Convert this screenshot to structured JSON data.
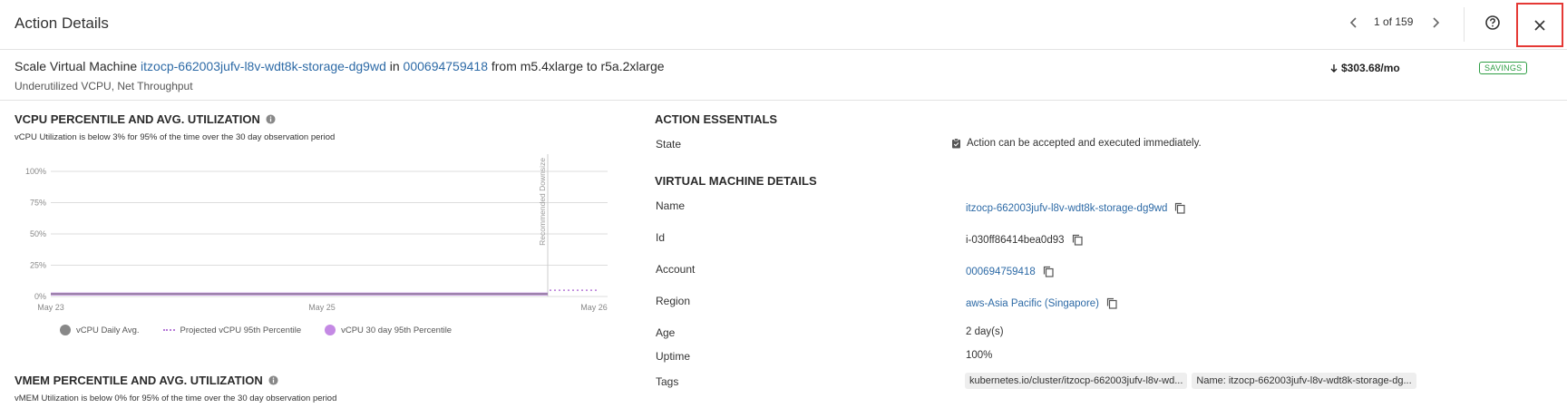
{
  "header": {
    "title": "Action Details",
    "pager_text": "1 of 159"
  },
  "summary": {
    "prefix": "Scale Virtual Machine",
    "vm_link": "itzocp-662003jufv-l8v-wdt8k-storage-dg9wd",
    "in_text": "in",
    "account_link": "000694759418",
    "resize_text": "from m5.4xlarge to r5a.2xlarge",
    "reasons": "Underutilized VCPU, Net Throughput",
    "savings_amount": "$303.68/mo",
    "savings_badge": "SAVINGS"
  },
  "vcpu_section": {
    "title": "VCPU PERCENTILE AND AVG. UTILIZATION",
    "subtitle": "vCPU Utilization is below 3% for 95% of the time over the 30 day observation period"
  },
  "vmem_section": {
    "title": "VMEM PERCENTILE AND AVG. UTILIZATION",
    "subtitle": "vMEM Utilization is below 0% for 95% of the time over the 30 day observation period"
  },
  "chart_data": {
    "type": "line",
    "y_ticks": [
      "100%",
      "75%",
      "50%",
      "25%",
      "0%"
    ],
    "ylim": [
      0,
      100
    ],
    "x_ticks": [
      "May 23",
      "May 25",
      "May 26"
    ],
    "marker_label": "Recommended Downsize",
    "series": [
      {
        "name": "vCPU Daily Avg.",
        "color": "#888888",
        "values": [
          2,
          2,
          2,
          2,
          2,
          2
        ]
      },
      {
        "name": "Projected vCPU 95th Percentile",
        "color": "#b77bd8",
        "values": [
          5,
          5
        ]
      },
      {
        "name": "vCPU 30 day 95th Percentile",
        "color": "#b77bd8",
        "values": [
          2,
          2,
          2,
          2,
          2,
          2
        ]
      }
    ]
  },
  "legend": {
    "daily_avg": "vCPU Daily Avg.",
    "projected": "Projected vCPU 95th Percentile",
    "thirty_day": "vCPU 30 day 95th Percentile"
  },
  "essentials": {
    "title": "ACTION ESSENTIALS",
    "state_label": "State",
    "state_value": "Action can be accepted and executed immediately."
  },
  "vm_details": {
    "title": "VIRTUAL MACHINE DETAILS",
    "name_label": "Name",
    "name_value": "itzocp-662003jufv-l8v-wdt8k-storage-dg9wd",
    "id_label": "Id",
    "id_value": "i-030ff86414bea0d93",
    "account_label": "Account",
    "account_value": "000694759418",
    "region_label": "Region",
    "region_value": "aws-Asia Pacific (Singapore)",
    "age_label": "Age",
    "age_value": "2 day(s)",
    "uptime_label": "Uptime",
    "uptime_value": "100%",
    "tags_label": "Tags",
    "tags": [
      "kubernetes.io/cluster/itzocp-662003jufv-l8v-wd...",
      "Name: itzocp-662003jufv-l8v-wdt8k-storage-dg..."
    ]
  },
  "colors": {
    "link": "#2d6aa6",
    "savings": "#2e9e44",
    "close_highlight": "#e53935",
    "series_purple": "#b77bd8",
    "series_gray": "#888888"
  }
}
